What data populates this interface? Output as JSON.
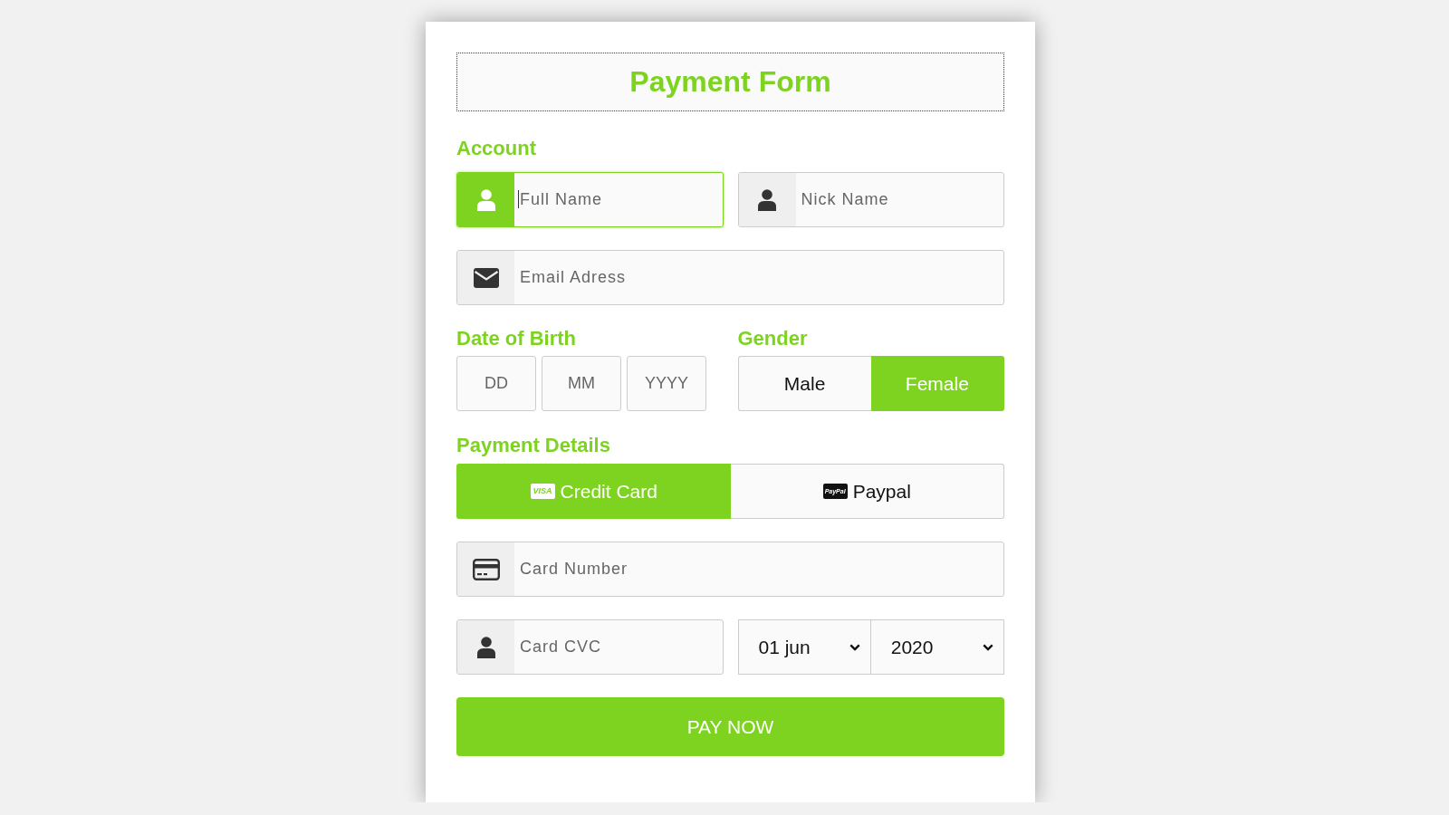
{
  "title": "Payment Form",
  "account": {
    "heading": "Account",
    "name_fields": [
      {
        "kind": "name",
        "placeholder": "Full Name",
        "focused": true
      },
      {
        "kind": "name",
        "placeholder": "Nick Name",
        "focused": false
      }
    ],
    "email_field": {
      "kind": "email",
      "placeholder": "Email Adress",
      "focused": false
    }
  },
  "date_of_birth": {
    "heading": "Date of Birth",
    "fields": [
      {
        "placeholder": "DD"
      },
      {
        "placeholder": "MM"
      },
      {
        "placeholder": "YYYY"
      }
    ]
  },
  "gender": {
    "heading": "Gender",
    "options": [
      {
        "label": "Male",
        "selected": false
      },
      {
        "label": "Female",
        "selected": true
      }
    ]
  },
  "payment_details": {
    "heading": "Payment Details",
    "methods": [
      {
        "kind": "card",
        "logo": "VISA",
        "label": "Credit Card",
        "selected": true
      },
      {
        "kind": "paypal",
        "logo": "PayPal",
        "label": "Paypal",
        "selected": false
      }
    ],
    "card_number": {
      "kind": "card",
      "placeholder": "Card Number",
      "focused": false
    },
    "card_cvc": {
      "kind": "cvc",
      "placeholder": "Card CVC",
      "focused": false
    },
    "expiry_month": {
      "value": "01 jun"
    },
    "expiry_year": {
      "value": "2020"
    }
  },
  "pay_button": {
    "label": "PAY NOW"
  }
}
